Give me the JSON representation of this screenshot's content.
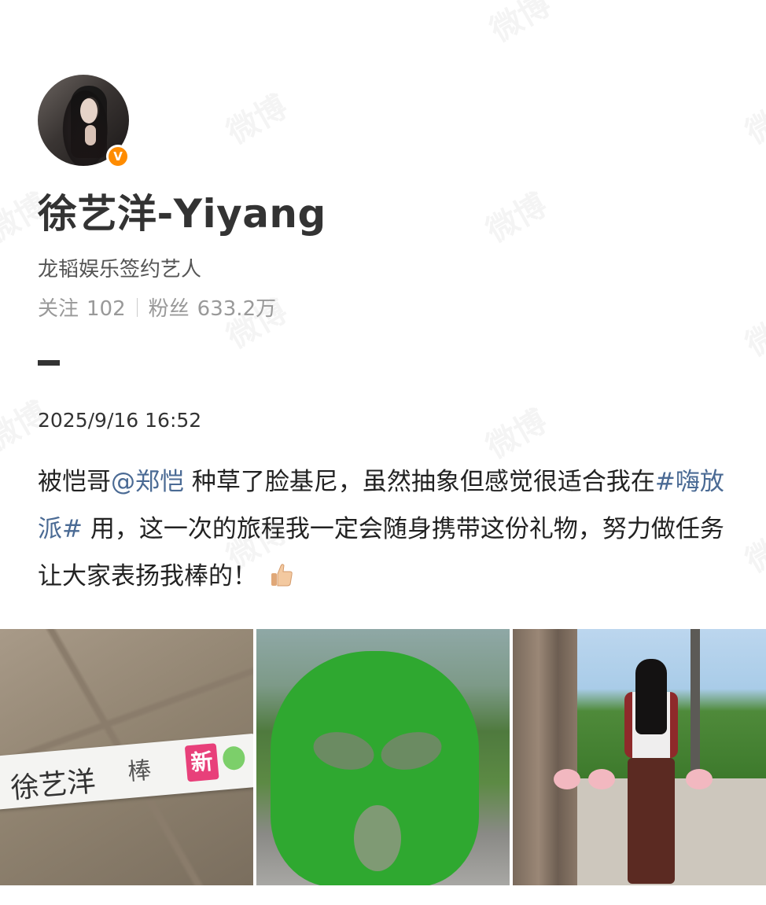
{
  "watermark": "微博",
  "profile": {
    "username": "徐艺洋-Yiyang",
    "verified_badge": "V",
    "bio": "龙韬娱乐签约艺人",
    "following_label": "关注",
    "following_count": "102",
    "followers_label": "粉丝",
    "followers_count": "633.2万"
  },
  "post": {
    "timestamp": "2025/9/16 16:52",
    "text_part1": "被恺哥",
    "mention": "@郑恺",
    "text_part2": " 种草了脸基尼，虽然抽象但感觉很适合我在",
    "hashtag": "#嗨放派#",
    "text_part3": " 用，这一次的旅程我一定会随身携带这份礼物，努力做任务让大家表扬我棒的！",
    "emoji": "thumbs-up-icon"
  },
  "photos": {
    "photo1": {
      "nameplate_name": "徐艺洋",
      "nameplate_hand": "棒",
      "nameplate_new": "新"
    },
    "photo2": {},
    "photo3": {}
  },
  "colors": {
    "link": "#4a6a94",
    "badge": "#ff8c00",
    "new_tag": "#e8407a"
  }
}
